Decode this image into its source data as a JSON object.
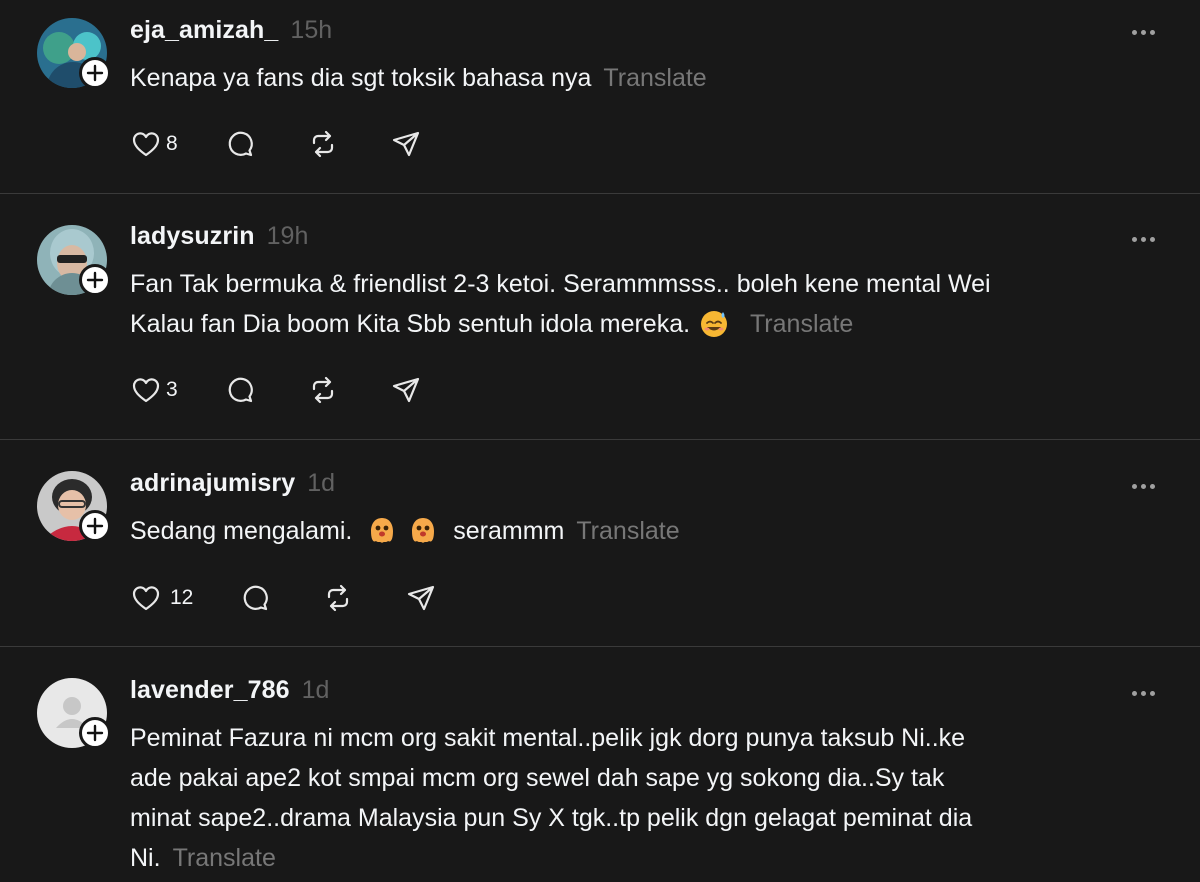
{
  "posts": [
    {
      "username": "eja_amizah_",
      "time": "15h",
      "text": "Kenapa ya fans dia sgt toksik bahasa nya",
      "translate": "Translate",
      "likes": "8"
    },
    {
      "username": "ladysuzrin",
      "time": "19h",
      "text_line1": "Fan Tak bermuka & friendlist 2-3 ketoi. Serammmsss.. boleh kene mental Wei",
      "text_line2": "Kalau fan Dia boom Kita Sbb sentuh idola mereka.",
      "emoji": "smiling-face-with-sweat-emoji",
      "translate": "Translate",
      "likes": "3"
    },
    {
      "username": "adrinajumisry",
      "time": "1d",
      "text_before": "Sedang mengalami.",
      "emoji": "cookie-monster-ghost-emoji",
      "text_after": "serammm",
      "translate": "Translate",
      "likes": "12"
    },
    {
      "username": "lavender_786",
      "time": "1d",
      "text_line1": "Peminat Fazura ni mcm org sakit mental..pelik jgk dorg punya taksub Ni..ke",
      "text_line2": "ade pakai ape2 kot smpai mcm org sewel dah sape yg sokong dia..Sy tak",
      "text_line3": "minat sape2..drama Malaysia pun Sy X tgk..tp pelik dgn gelagat peminat dia",
      "text_line4": "Ni.",
      "translate": "Translate"
    }
  ],
  "colors": {
    "background": "#181818",
    "text": "#f3f5f7",
    "muted": "#616161",
    "translate": "#777777",
    "divider": "#3a3a3a"
  },
  "icons": [
    "heart-icon",
    "reply-icon",
    "repost-icon",
    "share-icon",
    "more-icon",
    "follow-plus-icon"
  ]
}
